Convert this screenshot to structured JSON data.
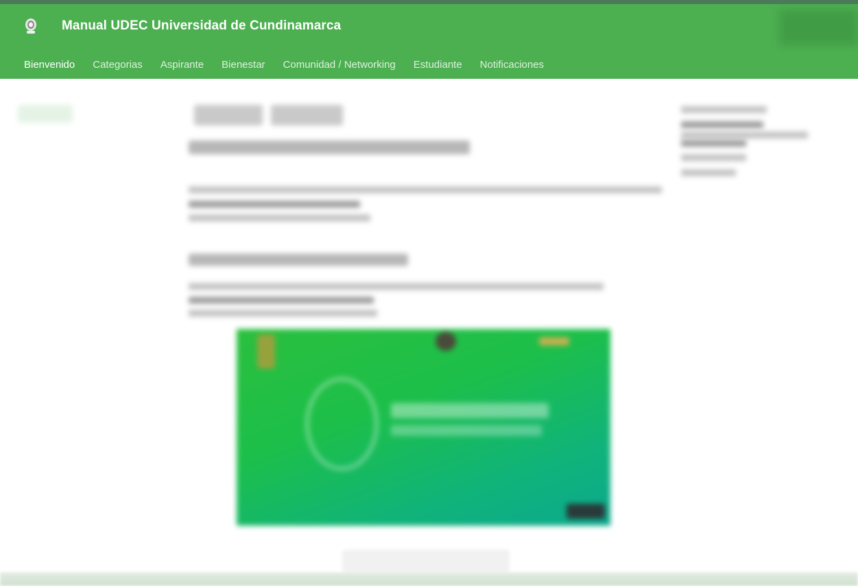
{
  "header": {
    "site_title": "Manual UDEC Universidad de Cundinamarca",
    "logo_icon": "university-seal-icon",
    "accent_color": "#4caf50"
  },
  "nav": {
    "items": [
      {
        "label": "Bienvenido",
        "active": true
      },
      {
        "label": "Categorias",
        "active": false
      },
      {
        "label": "Aspirante",
        "active": false
      },
      {
        "label": "Bienestar",
        "active": false
      },
      {
        "label": "Comunidad / Networking",
        "active": false
      },
      {
        "label": "Estudiante",
        "active": false
      },
      {
        "label": "Notificaciones",
        "active": false
      }
    ]
  }
}
